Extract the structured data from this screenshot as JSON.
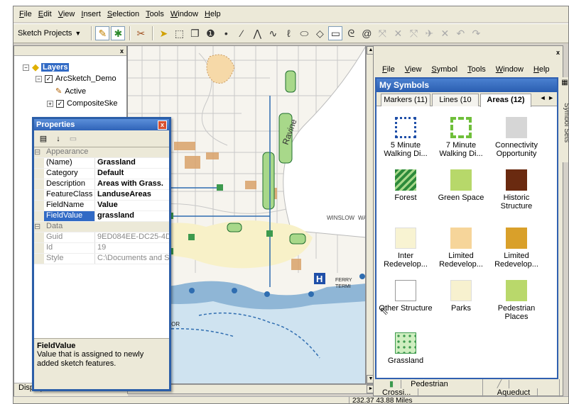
{
  "menubar": {
    "items": [
      "File",
      "Edit",
      "View",
      "Insert",
      "Selection",
      "Tools",
      "Window",
      "Help"
    ]
  },
  "toolbar": {
    "dropdown_label": "Sketch Projects",
    "tool_icons": [
      "sketch-pen-icon",
      "sketch-brush-icon",
      "eraser-icon",
      "select-arrow-icon",
      "edit-vertex-icon",
      "copy-feature-icon",
      "info-icon",
      "point-icon",
      "line-icon",
      "polyline-icon",
      "curve-icon",
      "freehand-icon",
      "ellipse-icon",
      "diamond-icon",
      "rectangle-icon",
      "lasso-icon",
      "spiral-icon",
      "disabled-tool-icon",
      "undo-icon",
      "redo-icon"
    ]
  },
  "toc": {
    "close_glyph": "x",
    "items": [
      {
        "label": "Layers"
      },
      {
        "label": "ArcSketch_Demo"
      },
      {
        "label": "Active"
      },
      {
        "label": "CompositeSke"
      }
    ],
    "bottom_tab": "Display"
  },
  "map": {
    "labels": {
      "ravine": "Ravine",
      "winslow": "WINSLOW",
      "way": "WAY",
      "eagle_harbor": "EAGLE HARBOR",
      "ferry": "FERRY",
      "terminal": "TERMI",
      "hospital": "H"
    }
  },
  "status": {
    "coordinates": "232.37  43.88 Miles"
  },
  "properties": {
    "title": "Properties",
    "close_glyph": "x",
    "rows": [
      {
        "category": "Appearance"
      },
      {
        "name": "(Name)",
        "value": "Grassland"
      },
      {
        "name": "Category",
        "value": "Default"
      },
      {
        "name": "Description",
        "value": "Areas with Grass."
      },
      {
        "name": "FeatureClass",
        "value": "LanduseAreas"
      },
      {
        "name": "FieldName",
        "value": "Value"
      },
      {
        "name": "FieldValue",
        "value": "grassland"
      },
      {
        "category": "Data"
      },
      {
        "name": "Guid",
        "value": "9ED084EE-DC25-4D"
      },
      {
        "name": "Id",
        "value": "19"
      },
      {
        "name": "Style",
        "value": "C:\\Documents and S"
      }
    ],
    "help_title": "FieldValue",
    "help_text": "Value that is assigned to newly added sketch features."
  },
  "symbols": {
    "close_glyph": "x",
    "menu": [
      "File",
      "View",
      "Symbol",
      "Tools",
      "Window",
      "Help"
    ],
    "title": "My Symbols",
    "tabs": [
      "Markers (11)",
      "Lines (10",
      "Areas (12)"
    ],
    "tab_nav": "◄ ►",
    "side_label": "Symbol Sets",
    "items": [
      {
        "label": "5 Minute Walking Di...",
        "color": "#1f4fa8"
      },
      {
        "label": "7 Minute Walking Di...",
        "color": "#6fbf3a"
      },
      {
        "label": "Connectivity Opportunity",
        "color": "#d6d6d6"
      },
      {
        "label": "Forest",
        "color": "#2c8a3a"
      },
      {
        "label": "Green Space",
        "color": "#b7d86a"
      },
      {
        "label": "Historic Structure",
        "color": "#6a2a10"
      },
      {
        "label": "Inter Redevelop...",
        "color": "#f8f3d2"
      },
      {
        "label": "Limited Redevelop...",
        "color": "#f6d59a"
      },
      {
        "label": "Limited Redevelop...",
        "color": "#d9a02a"
      },
      {
        "label": "Other Structure",
        "color": "#ffffff"
      },
      {
        "label": "Parks",
        "color": "#f7f1cf"
      },
      {
        "label": "Pedestrian Places",
        "color": "#b9d86b"
      },
      {
        "label": "Grassland",
        "color": "#3d9a4e"
      }
    ],
    "bottom_tabs": [
      "Pedestrian Crossi...",
      "Aqueduct"
    ]
  }
}
